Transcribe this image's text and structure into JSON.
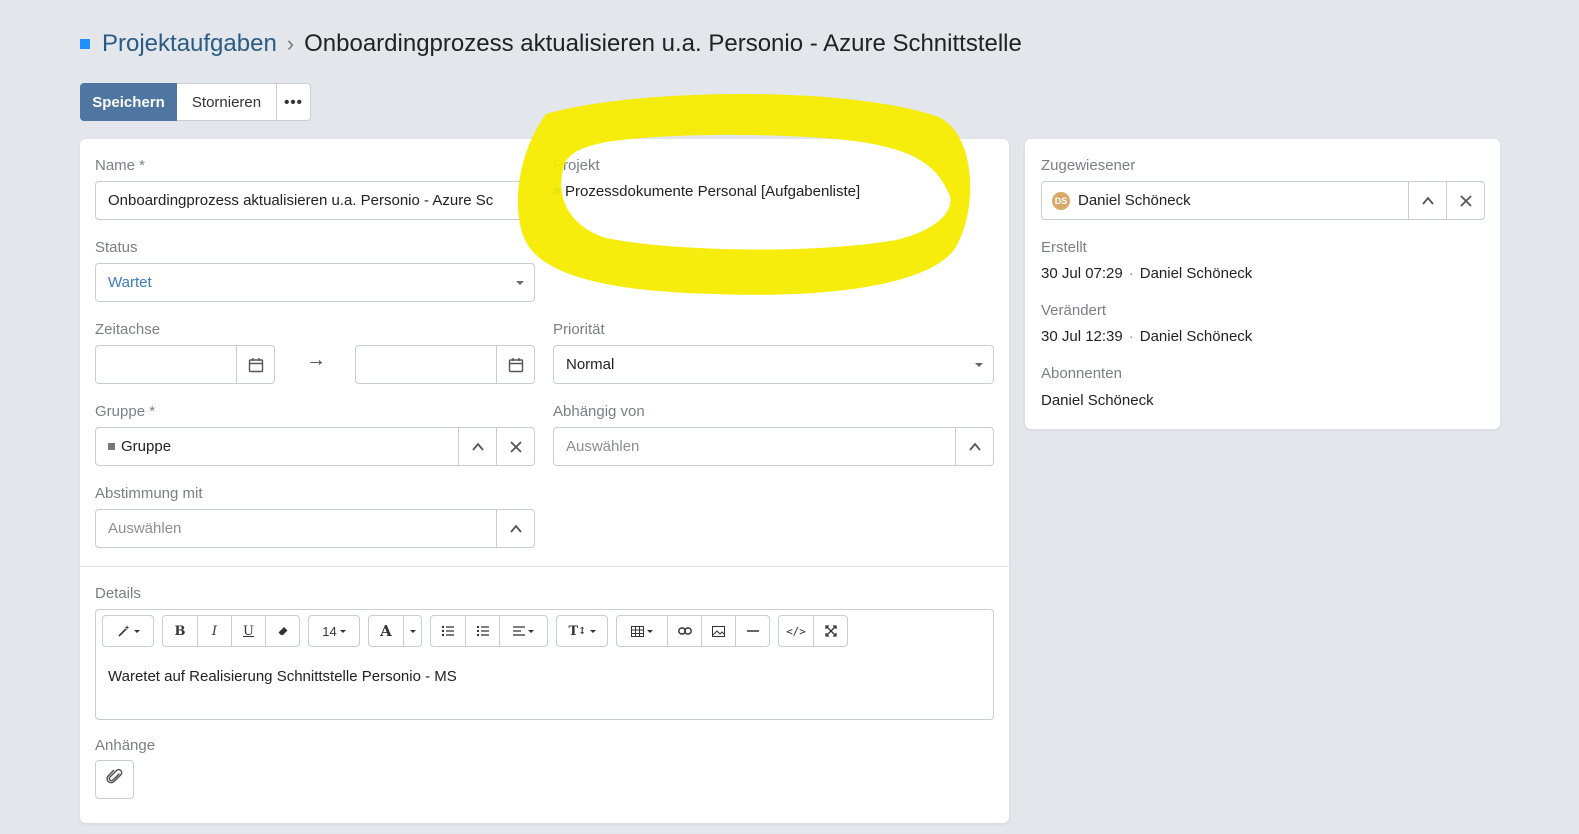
{
  "breadcrumb": {
    "parent": "Projektaufgaben",
    "separator": "›",
    "title": "Onboardingprozess aktualisieren u.a. Personio - Azure Schnittstelle"
  },
  "toolbar": {
    "save_label": "Speichern",
    "cancel_label": "Stornieren",
    "more_label": "•••"
  },
  "form": {
    "name": {
      "label": "Name *",
      "value": "Onboardingprozess aktualisieren u.a. Personio - Azure Sc"
    },
    "project": {
      "label": "Projekt",
      "value": "Prozessdokumente Personal [Aufgabenliste]"
    },
    "status": {
      "label": "Status",
      "value": "Wartet"
    },
    "timeline": {
      "label": "Zeitachse",
      "arrow": "→"
    },
    "priority": {
      "label": "Priorität",
      "value": "Normal"
    },
    "group": {
      "label": "Gruppe *",
      "value": "Gruppe"
    },
    "depends_on": {
      "label": "Abhängig von",
      "placeholder": "Auswählen"
    },
    "coordination": {
      "label": "Abstimmung mit",
      "placeholder": "Auswählen"
    },
    "details": {
      "label": "Details",
      "font_size": "14",
      "content": "Waretet auf Realisierung Schnittstelle Personio - MS"
    },
    "attachments": {
      "label": "Anhänge"
    }
  },
  "sidebar": {
    "assignee": {
      "label": "Zugewiesener",
      "initials": "DS",
      "name": "Daniel Schöneck"
    },
    "created": {
      "label": "Erstellt",
      "date": "30 Jul 07:29",
      "separator": "·",
      "user": "Daniel Schöneck"
    },
    "modified": {
      "label": "Verändert",
      "date": "30 Jul 12:39",
      "separator": "·",
      "user": "Daniel Schöneck"
    },
    "subscribers": {
      "label": "Abonnenten",
      "value": "Daniel Schöneck"
    }
  },
  "colors": {
    "primary": "#4f76a0",
    "link": "#2b5b85",
    "highlight": "#f5ec00",
    "background": "#e3e7eb"
  }
}
